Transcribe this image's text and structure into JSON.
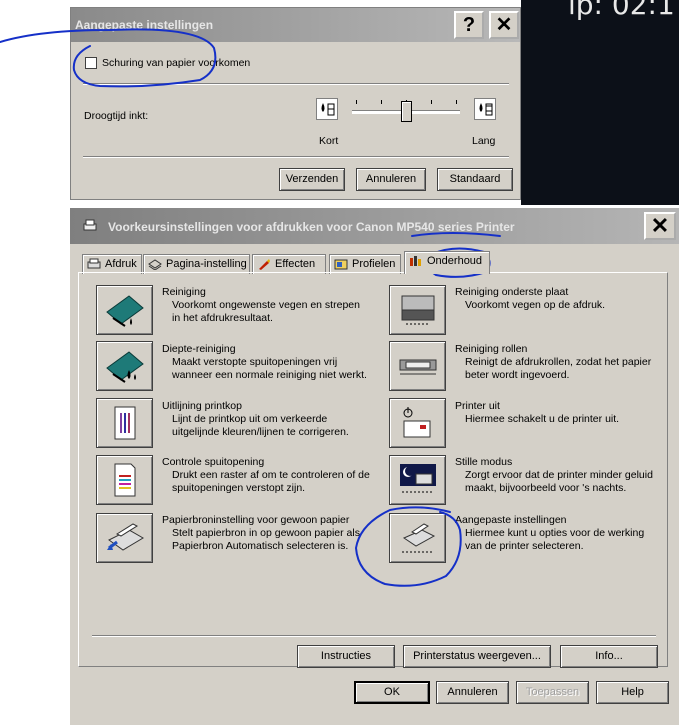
{
  "background_text": "ip: 02:1",
  "top_dialog": {
    "title": "Aangepaste instellingen",
    "help_btn": "?",
    "close_btn": "✕",
    "checkbox_label": "Schuring van papier voorkomen",
    "dry_label": "Droogtijd inkt:",
    "slider_min": "Kort",
    "slider_max": "Lang",
    "slider_level": 0.5,
    "buttons": {
      "send": "Verzenden",
      "cancel": "Annuleren",
      "default": "Standaard"
    }
  },
  "main_dialog": {
    "title": "Voorkeursinstellingen voor afdrukken voor Canon MP540 series Printer",
    "close_btn": "✕",
    "tabs": [
      {
        "label": "Afdruk"
      },
      {
        "label": "Pagina-instelling"
      },
      {
        "label": "Effecten"
      },
      {
        "label": "Profielen"
      },
      {
        "label": "Onderhoud"
      }
    ],
    "left_items": [
      {
        "title": "Reiniging",
        "desc": [
          "Voorkomt ongewenste vegen en strepen",
          "in het afdrukresultaat."
        ],
        "icon": "cleaning-icon"
      },
      {
        "title": "Diepte-reiniging",
        "desc": [
          "Maakt verstopte spuitopeningen vrij",
          "wanneer een normale reiniging niet werkt."
        ],
        "icon": "deep-cleaning-icon"
      },
      {
        "title": "Uitlijning printkop",
        "desc": [
          "Lijnt de printkop uit om verkeerde",
          "uitgelijnde kleuren/lijnen te corrigeren."
        ],
        "icon": "print-head-alignment-icon"
      },
      {
        "title": "Controle spuitopening",
        "desc": [
          "Drukt een raster af om te controleren of de",
          "spuitopeningen verstopt zijn."
        ],
        "icon": "nozzle-check-icon"
      },
      {
        "title": "Papierbroninstelling voor gewoon papier",
        "desc": [
          "Stelt papierbron in op gewoon papier als",
          "Papierbron Automatisch selecteren is."
        ],
        "icon": "paper-source-icon"
      }
    ],
    "right_items": [
      {
        "title": "Reiniging onderste plaat",
        "desc": [
          "Voorkomt vegen op de afdruk."
        ],
        "icon": "bottom-plate-cleaning-icon"
      },
      {
        "title": "Reiniging rollen",
        "desc": [
          "Reinigt de afdrukrollen, zodat het papier",
          "beter wordt ingevoerd."
        ],
        "icon": "roller-cleaning-icon"
      },
      {
        "title": "Printer uit",
        "desc": [
          "Hiermee schakelt u de printer uit."
        ],
        "icon": "power-off-icon"
      },
      {
        "title": "Stille modus",
        "desc": [
          "Zorgt ervoor dat de printer minder geluid",
          "maakt, bijvoorbeeld voor 's nachts."
        ],
        "icon": "quiet-mode-icon"
      },
      {
        "title": "Aangepaste instellingen",
        "desc": [
          "Hiermee kunt u opties voor de werking",
          "van de printer selecteren."
        ],
        "icon": "custom-settings-icon"
      }
    ],
    "panel_buttons": {
      "instructions": "Instructies",
      "status": "Printerstatus weergeven...",
      "info": "Info..."
    },
    "bottom_buttons": {
      "ok": "OK",
      "cancel": "Annuleren",
      "apply": "Toepassen",
      "help": "Help"
    }
  },
  "colors": {
    "annotation": "#1530c8",
    "title_bar": "#9a9a9a",
    "dialog_face": "#d4d0c8"
  }
}
